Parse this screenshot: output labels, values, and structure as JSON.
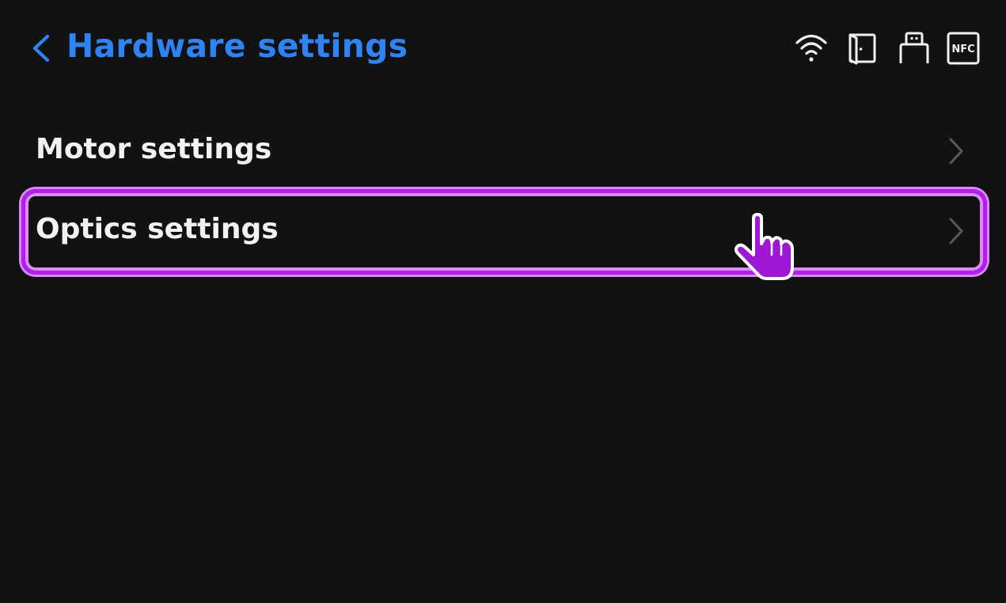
{
  "header": {
    "title": "Hardware settings",
    "back_icon": "chevron-left-icon",
    "accent_color": "#2f84f5"
  },
  "status_bar": {
    "icons": [
      "wifi-icon",
      "door-icon",
      "usb-icon",
      "nfc-icon"
    ],
    "nfc_label": "NFC"
  },
  "menu": {
    "items": [
      {
        "label": "Motor settings",
        "icon": "chevron-right-icon"
      },
      {
        "label": "Optics settings",
        "icon": "chevron-right-icon",
        "highlighted": true
      }
    ]
  },
  "overlay": {
    "highlight_color": "#b51cf2",
    "cursor_icon": "hand-pointer-icon"
  }
}
